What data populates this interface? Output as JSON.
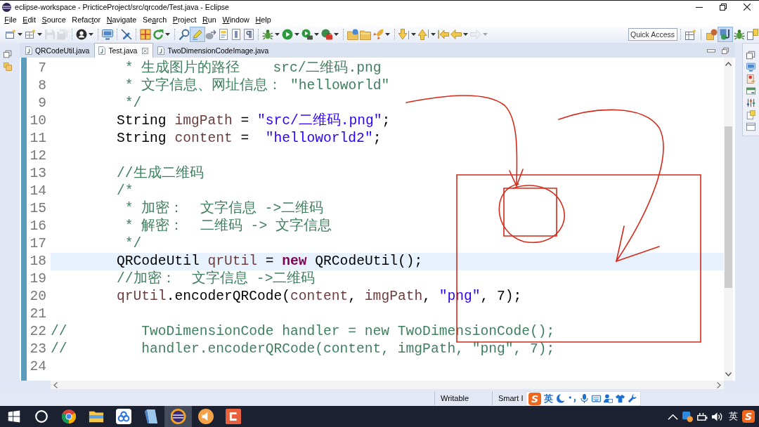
{
  "window": {
    "title": "eclipse-workspace - PricticeProject/src/qrcode/Test.java - Eclipse"
  },
  "menu": [
    {
      "key": "F",
      "rest": "ile"
    },
    {
      "key": "E",
      "rest": "dit"
    },
    {
      "key": "S",
      "rest": "ource"
    },
    {
      "lead": "Refac",
      "key": "t",
      "rest": "or"
    },
    {
      "key": "N",
      "rest": "avigate"
    },
    {
      "lead": "Se",
      "key": "a",
      "rest": "rch"
    },
    {
      "key": "P",
      "rest": "roject"
    },
    {
      "key": "R",
      "rest": "un"
    },
    {
      "key": "W",
      "rest": "indow"
    },
    {
      "key": "H",
      "rest": "elp"
    }
  ],
  "toolbar": {
    "groups": [
      [
        {
          "kind": "newwin",
          "dropdown": true,
          "disabled": false,
          "pressed": false
        },
        {
          "kind": "newgrid",
          "dropdown": true,
          "disabled": false,
          "pressed": false
        },
        {
          "kind": "save",
          "dropdown": false,
          "disabled": true,
          "pressed": false
        },
        {
          "kind": "saveall",
          "dropdown": false,
          "disabled": true,
          "pressed": false
        }
      ],
      [
        {
          "kind": "profile",
          "dropdown": true,
          "disabled": false,
          "pressed": false
        }
      ],
      [
        {
          "kind": "console",
          "dropdown": false,
          "disabled": false,
          "pressed": false
        }
      ],
      [
        {
          "kind": "skipbp",
          "dropdown": false,
          "disabled": false,
          "pressed": false
        }
      ],
      [
        {
          "kind": "build",
          "dropdown": false,
          "disabled": false,
          "pressed": false
        },
        {
          "kind": "refresh",
          "dropdown": true,
          "disabled": false,
          "pressed": false
        }
      ],
      [
        {
          "kind": "pin",
          "dropdown": false,
          "disabled": false,
          "pressed": false
        },
        {
          "kind": "brush",
          "dropdown": false,
          "disabled": false,
          "pressed": true
        },
        {
          "kind": "link",
          "dropdown": false,
          "disabled": false,
          "pressed": false
        },
        {
          "kind": "annot",
          "dropdown": false,
          "disabled": false,
          "pressed": false
        },
        {
          "kind": "block",
          "dropdown": false,
          "disabled": false,
          "pressed": false
        },
        {
          "kind": "para",
          "dropdown": false,
          "disabled": false,
          "pressed": false
        }
      ],
      [
        {
          "kind": "debug",
          "dropdown": true,
          "disabled": false,
          "pressed": false
        },
        {
          "kind": "run",
          "dropdown": true,
          "disabled": false,
          "pressed": false
        },
        {
          "kind": "runext",
          "dropdown": true,
          "disabled": false,
          "pressed": false
        },
        {
          "kind": "tool",
          "dropdown": true,
          "disabled": false,
          "pressed": false
        }
      ],
      [
        {
          "kind": "folderglobe",
          "dropdown": false,
          "disabled": false,
          "pressed": false
        },
        {
          "kind": "folder",
          "dropdown": false,
          "disabled": false,
          "pressed": false
        },
        {
          "kind": "rocket",
          "dropdown": true,
          "disabled": false,
          "pressed": false
        }
      ],
      [
        {
          "kind": "down",
          "dropdown": true,
          "disabled": false,
          "pressed": false
        },
        {
          "kind": "up",
          "dropdown": true,
          "disabled": false,
          "pressed": false
        },
        {
          "kind": "backedit",
          "dropdown": false,
          "disabled": false,
          "pressed": false
        },
        {
          "kind": "back",
          "dropdown": true,
          "disabled": false,
          "pressed": false
        },
        {
          "kind": "forward",
          "dropdown": true,
          "disabled": true,
          "pressed": false
        }
      ]
    ],
    "quick_access": {
      "placeholder": "Quick Access"
    },
    "perspectives": [
      {
        "kind": "openpersp",
        "selected": false
      },
      {
        "kind": "resource",
        "selected": false
      },
      {
        "kind": "java",
        "selected": true
      },
      {
        "kind": "debugp",
        "selected": false
      },
      {
        "kind": "team",
        "selected": false
      }
    ]
  },
  "editor": {
    "tabs": [
      {
        "label": "QRCodeUtil.java",
        "selected": false
      },
      {
        "label": "Test.java",
        "selected": true
      },
      {
        "label": "TwoDimensionCodeImage.java",
        "selected": false
      }
    ],
    "lines": [
      {
        "number": "7",
        "current": false,
        "tokens": [
          {
            "kind": "comment",
            "text": "         * 生成图片的路径    src/二维码.png"
          }
        ]
      },
      {
        "number": "8",
        "current": false,
        "tokens": [
          {
            "kind": "comment",
            "text": "         * 文字信息、网址信息： \"helloworld\""
          }
        ]
      },
      {
        "number": "9",
        "current": false,
        "tokens": [
          {
            "kind": "comment",
            "text": "         */"
          }
        ]
      },
      {
        "number": "10",
        "current": false,
        "tokens": [
          {
            "kind": "plain",
            "text": "        String"
          },
          {
            "kind": "variable",
            "text": " imgPath"
          },
          {
            "kind": "plain",
            "text": " ="
          },
          {
            "kind": "string",
            "text": " \"src/二维码.png\""
          },
          {
            "kind": "plain",
            "text": ";"
          }
        ]
      },
      {
        "number": "11",
        "current": false,
        "tokens": [
          {
            "kind": "plain",
            "text": "        String"
          },
          {
            "kind": "variable",
            "text": " content"
          },
          {
            "kind": "plain",
            "text": " ="
          },
          {
            "kind": "string",
            "text": "  \"helloworld2\""
          },
          {
            "kind": "plain",
            "text": ";"
          }
        ]
      },
      {
        "number": "12",
        "current": false
      },
      {
        "number": "13",
        "current": false,
        "tokens": [
          {
            "kind": "comment",
            "text": "        //生成二维码"
          }
        ]
      },
      {
        "number": "14",
        "current": false,
        "tokens": [
          {
            "kind": "comment",
            "text": "        /*"
          }
        ]
      },
      {
        "number": "15",
        "current": false,
        "tokens": [
          {
            "kind": "comment",
            "text": "         * 加密：  文字信息 ->二维码"
          }
        ]
      },
      {
        "number": "16",
        "current": false,
        "tokens": [
          {
            "kind": "comment",
            "text": "         * 解密：  二维码 -> 文字信息"
          }
        ]
      },
      {
        "number": "17",
        "current": false,
        "tokens": [
          {
            "kind": "comment",
            "text": "         */"
          }
        ]
      },
      {
        "number": "18",
        "current": true,
        "tokens": [
          {
            "kind": "plain",
            "text": "        QRCodeUtil"
          },
          {
            "kind": "variable",
            "text": " qrUtil"
          },
          {
            "kind": "plain",
            "text": " ="
          },
          {
            "kind": "keyword",
            "text": " new"
          },
          {
            "kind": "plain",
            "text": " QRCodeUtil();"
          }
        ]
      },
      {
        "number": "19",
        "current": false,
        "tokens": [
          {
            "kind": "comment",
            "text": "        //加密：  文字信息 ->二维码"
          }
        ]
      },
      {
        "number": "20",
        "current": false,
        "tokens": [
          {
            "kind": "variable",
            "text": "        qrUtil"
          },
          {
            "kind": "plain",
            "text": ".encoderQRCode("
          },
          {
            "kind": "variable",
            "text": "content"
          },
          {
            "kind": "plain",
            "text": ","
          },
          {
            "kind": "variable",
            "text": " imgPath"
          },
          {
            "kind": "plain",
            "text": ","
          },
          {
            "kind": "string",
            "text": " \"png\""
          },
          {
            "kind": "plain",
            "text": ", 7);"
          }
        ]
      },
      {
        "number": "21",
        "current": false
      },
      {
        "number": "22",
        "current": false,
        "tokens": [
          {
            "kind": "comment",
            "text": "//         TwoDimensionCode handler = new TwoDimensionCode();"
          }
        ]
      },
      {
        "number": "23",
        "current": false,
        "tokens": [
          {
            "kind": "comment",
            "text": "//         handler.encoderQRCode(content, imgPath, \"png\", 7);"
          }
        ]
      },
      {
        "number": "24",
        "current": false
      }
    ]
  },
  "status_bar": {
    "fields": [
      "Writable",
      "Smart I"
    ]
  },
  "ime_toolbar": {
    "logo": "S",
    "mode": "英"
  },
  "taskbar": {
    "apps": [
      {
        "kind": "start",
        "active": false
      },
      {
        "kind": "search",
        "active": false
      },
      {
        "kind": "browser",
        "active": false
      },
      {
        "kind": "files",
        "active": false
      },
      {
        "kind": "cloud",
        "active": false
      },
      {
        "kind": "notes",
        "active": false
      },
      {
        "kind": "ide",
        "active": true
      },
      {
        "kind": "audio",
        "active": false
      },
      {
        "kind": "capp",
        "active": false
      }
    ],
    "tray": {
      "icons": [
        {
          "kind": "chevron"
        },
        {
          "kind": "network"
        },
        {
          "kind": "power"
        },
        {
          "kind": "volume"
        }
      ],
      "ime_mode": "英",
      "logo": "S"
    }
  }
}
